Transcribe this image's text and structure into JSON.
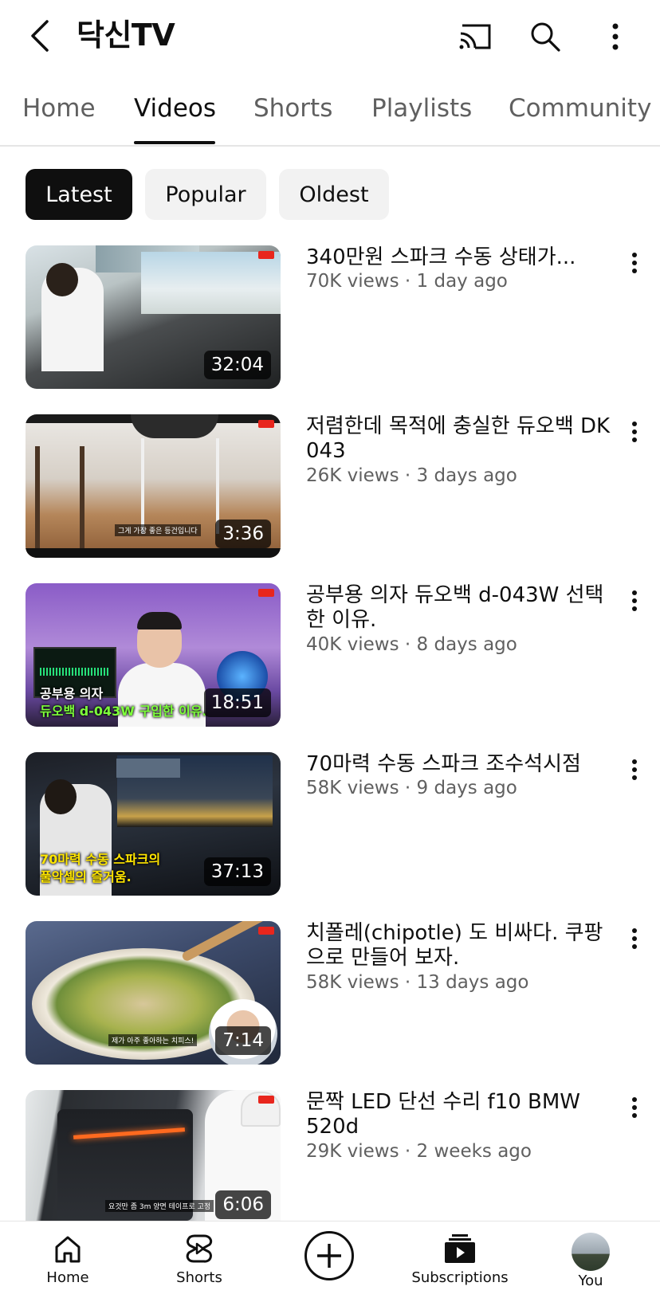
{
  "header": {
    "channel_title": "닥신TV",
    "icons": [
      "back-icon",
      "cast-icon",
      "search-icon",
      "more-vertical-icon"
    ]
  },
  "tabs": [
    {
      "label": "Home",
      "active": false
    },
    {
      "label": "Videos",
      "active": true
    },
    {
      "label": "Shorts",
      "active": false
    },
    {
      "label": "Playlists",
      "active": false
    },
    {
      "label": "Community",
      "active": false
    }
  ],
  "chips": [
    {
      "label": "Latest",
      "selected": true
    },
    {
      "label": "Popular",
      "selected": false
    },
    {
      "label": "Oldest",
      "selected": false
    }
  ],
  "videos": [
    {
      "title": "340만원 스파크 수동 상태가...",
      "meta": "70K views · 1 day ago",
      "duration": "32:04"
    },
    {
      "title": "저렴한데 목적에 충실한 듀오백 DK 043",
      "meta": "26K views · 3 days ago",
      "duration": "3:36",
      "caption": "그게 가장 좋은 등건입니다"
    },
    {
      "title": "공부용 의자 듀오백 d-043W 선택한 이유.",
      "meta": "40K views · 8 days ago",
      "duration": "18:51",
      "caption_line1": "공부용 의자",
      "caption_line2": "듀오백 d-043W  구입한 이유."
    },
    {
      "title": "70마력 수동 스파크 조수석시점",
      "meta": "58K views · 9 days ago",
      "duration": "37:13",
      "caption_line1": "70마력 수동 스파크의",
      "caption_line2": "풀악셀의 즐거움."
    },
    {
      "title": "치폴레(chipotle) 도 비싸다. 쿠팡으로 만들어 보자.",
      "meta": "58K views · 13 days ago",
      "duration": "7:14",
      "caption": "제가 아주 좋아하는 치피스!"
    },
    {
      "title": "문짝 LED 단선 수리  f10 BMW 520d",
      "meta": "29K views · 2 weeks ago",
      "duration": "6:06",
      "caption": "요것만 좀 3m 양면 테이프로 고정"
    }
  ],
  "bottom_nav": [
    {
      "label": "Home",
      "icon": "home-icon"
    },
    {
      "label": "Shorts",
      "icon": "shorts-icon"
    },
    {
      "label": "",
      "icon": "create-plus-icon"
    },
    {
      "label": "Subscriptions",
      "icon": "subscriptions-icon"
    },
    {
      "label": "You",
      "icon": "avatar"
    }
  ]
}
